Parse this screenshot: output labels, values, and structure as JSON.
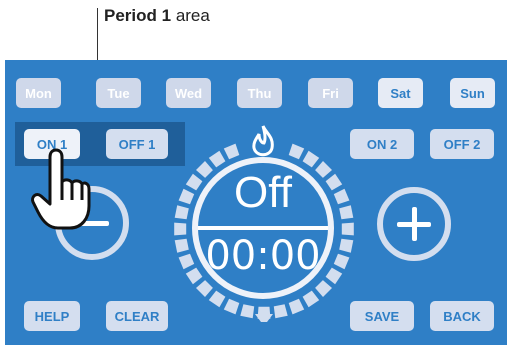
{
  "annotation": {
    "bold": "Period 1",
    "rest": " area"
  },
  "days": [
    "Mon",
    "Tue",
    "Wed",
    "Thu",
    "Fri",
    "Sat",
    "Sun"
  ],
  "period_buttons": {
    "on1": "ON 1",
    "off1": "OFF 1",
    "on2": "ON 2",
    "off2": "OFF 2"
  },
  "dial": {
    "state": "Off",
    "time": "00:00"
  },
  "footer": {
    "help": "HELP",
    "clear": "CLEAR",
    "save": "SAVE",
    "back": "BACK"
  },
  "icons": {
    "flame": "flame-icon",
    "hand": "pointing-hand-icon",
    "minus": "minus-icon",
    "plus": "plus-icon"
  },
  "colors": {
    "panel": "#2f7fc6",
    "period_area": "#1f5f9a",
    "button": "#d4deef",
    "text_blue": "#2f7fc6"
  }
}
